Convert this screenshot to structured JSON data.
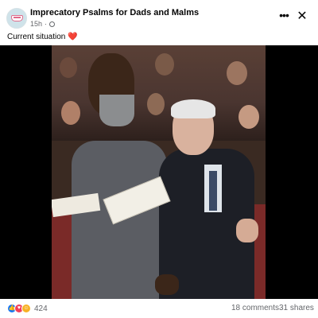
{
  "post": {
    "page_name": "Imprecatory Psalms for Dads and Malms",
    "time": "15h",
    "separator": "·",
    "caption": "Current situation",
    "caption_emoji": "❤️",
    "more_label": "•••",
    "close_label": "✕"
  },
  "footer": {
    "reaction_count": "424",
    "comments": "18 comments",
    "shares": "31 shares",
    "reaction_icons": [
      "like-icon",
      "love-icon",
      "haha-icon"
    ]
  },
  "colors": {
    "text": "#050505",
    "secondary": "#65676b",
    "like": "#1877f2",
    "love": "#f33e58",
    "haha": "#f7b125"
  }
}
